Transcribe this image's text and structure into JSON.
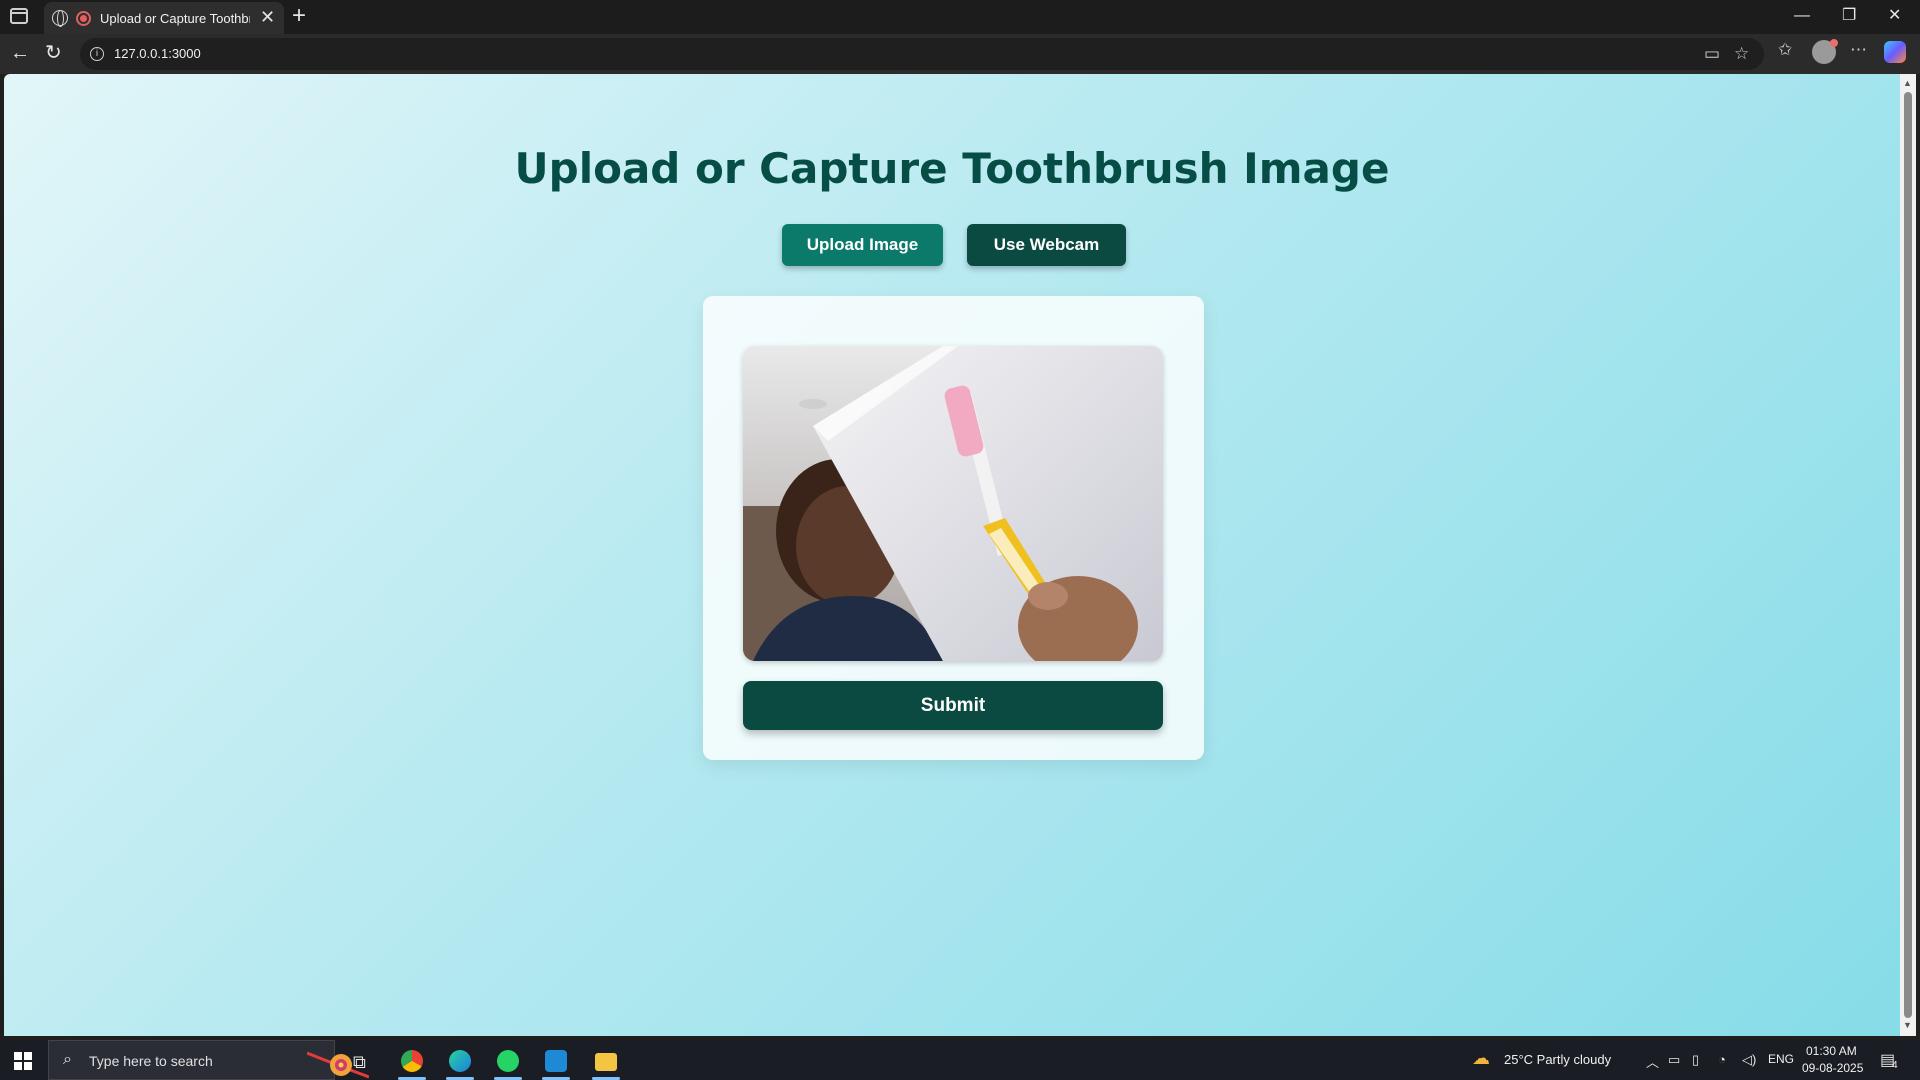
{
  "browser": {
    "tab_title": "Upload or Capture Toothbrush Image",
    "url": "127.0.0.1:3000"
  },
  "page": {
    "title": "Upload or Capture Toothbrush Image",
    "upload_label": "Upload Image",
    "webcam_label": "Use Webcam",
    "submit_label": "Submit"
  },
  "taskbar": {
    "search_placeholder": "Type here to search",
    "weather": "25°C  Partly cloudy",
    "language": "ENG",
    "time": "01:30 AM",
    "date": "09-08-2025",
    "notifications": "4"
  },
  "colors": {
    "title": "#064d45",
    "upload_button": "#0b7a6b",
    "webcam_button": "#0b4a40",
    "submit_button": "#0b4a40"
  }
}
